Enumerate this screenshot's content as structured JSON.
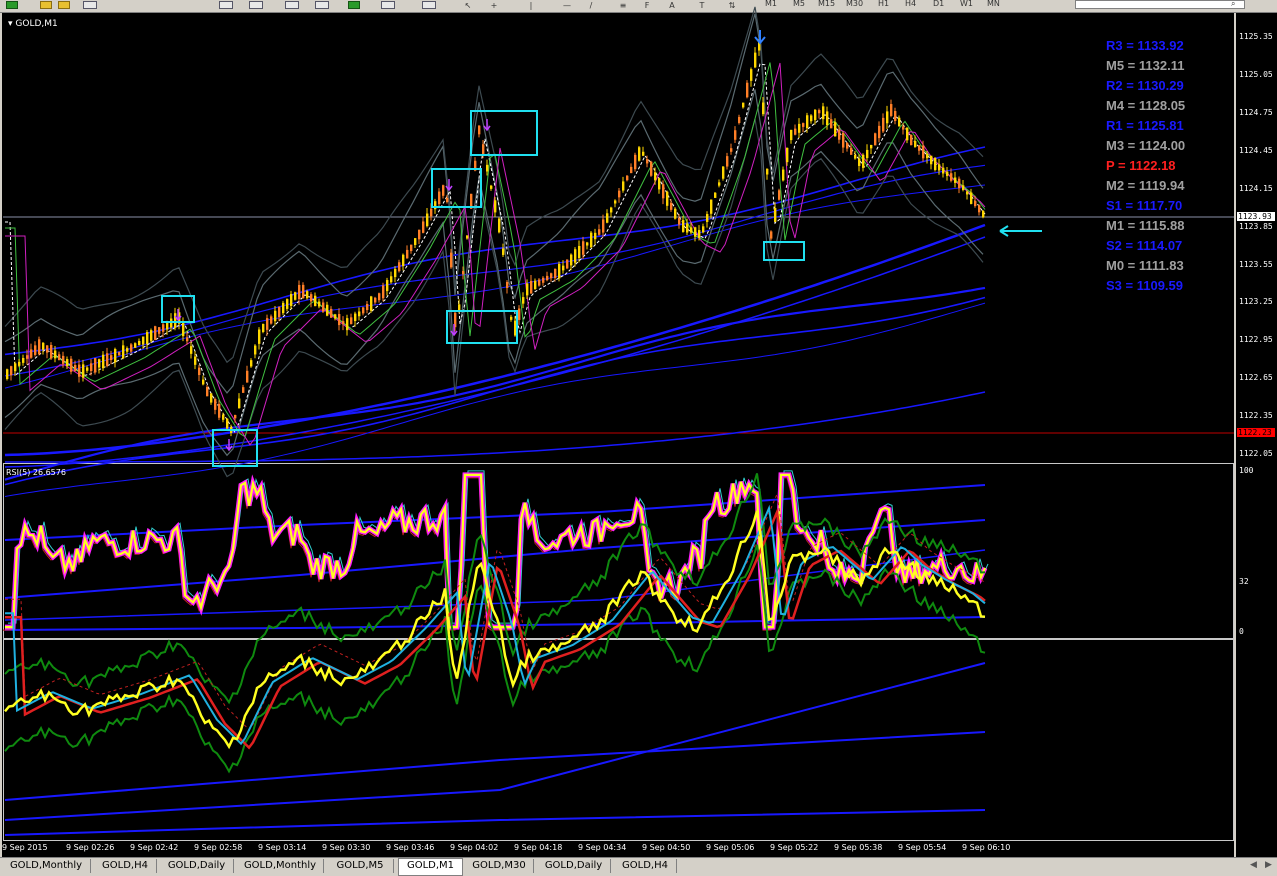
{
  "window": {
    "symbol_label": "GOLD,M1"
  },
  "toolbar": {
    "timeframes": [
      "M1",
      "M5",
      "M15",
      "M30",
      "H1",
      "H4",
      "D1",
      "W1",
      "MN"
    ]
  },
  "indicator_labels": {
    "rsi": "RSI(5) 26.6576"
  },
  "price_scale": {
    "ticks": [
      "1125.35",
      "1125.05",
      "1124.75",
      "1124.45",
      "1124.15",
      "1123.85",
      "1123.55",
      "1123.25",
      "1122.95",
      "1122.65",
      "1122.35",
      "1122.05"
    ],
    "current_price": "1123.93",
    "red_level": "1122.23",
    "current_color": "#ffffff",
    "red_color": "#ff0000"
  },
  "rsi_scale": {
    "ticks": [
      "100",
      "32",
      "0"
    ]
  },
  "pivots": [
    {
      "label": "R3 = 1133.92",
      "color": "#1a1aff"
    },
    {
      "label": "M5 = 1132.11",
      "color": "#a0a0a0"
    },
    {
      "label": "R2 = 1130.29",
      "color": "#1a1aff"
    },
    {
      "label": "M4 = 1128.05",
      "color": "#a0a0a0"
    },
    {
      "label": "R1 = 1125.81",
      "color": "#1a1aff"
    },
    {
      "label": "M3 = 1124.00",
      "color": "#a0a0a0"
    },
    {
      "label": "P  = 1122.18",
      "color": "#ff2020"
    },
    {
      "label": "M2 = 1119.94",
      "color": "#a0a0a0"
    },
    {
      "label": "S1 = 1117.70",
      "color": "#1a1aff"
    },
    {
      "label": "M1 = 1115.88",
      "color": "#a0a0a0"
    },
    {
      "label": "S2 = 1114.07",
      "color": "#1a1aff"
    },
    {
      "label": "M0 = 1111.83",
      "color": "#a0a0a0"
    },
    {
      "label": "S3 = 1109.59",
      "color": "#1a1aff"
    }
  ],
  "time_axis": [
    "9 Sep 2015",
    "9 Sep 02:26",
    "9 Sep 02:42",
    "9 Sep 02:58",
    "9 Sep 03:14",
    "9 Sep 03:30",
    "9 Sep 03:46",
    "9 Sep 04:02",
    "9 Sep 04:18",
    "9 Sep 04:34",
    "9 Sep 04:50",
    "9 Sep 05:06",
    "9 Sep 05:22",
    "9 Sep 05:38",
    "9 Sep 05:54",
    "9 Sep 06:10"
  ],
  "tabs": [
    {
      "label": "GOLD,Monthly",
      "active": false
    },
    {
      "label": "GOLD,H4",
      "active": false
    },
    {
      "label": "GOLD,Daily",
      "active": false
    },
    {
      "label": "GOLD,Monthly",
      "active": false
    },
    {
      "label": "GOLD,M5",
      "active": false
    },
    {
      "label": "GOLD,M1",
      "active": true
    },
    {
      "label": "GOLD,M30",
      "active": false
    },
    {
      "label": "GOLD,Daily",
      "active": false
    },
    {
      "label": "GOLD,H4",
      "active": false
    }
  ],
  "colors": {
    "background": "#000000",
    "bull_candle": "#ffd700",
    "bear_candle": "#ff7f27",
    "highlight_box": "#20e0f0",
    "rsi_main": "#ffff20",
    "rsi_glow": "#ff20ff",
    "band_blue": "#1818ff"
  }
}
